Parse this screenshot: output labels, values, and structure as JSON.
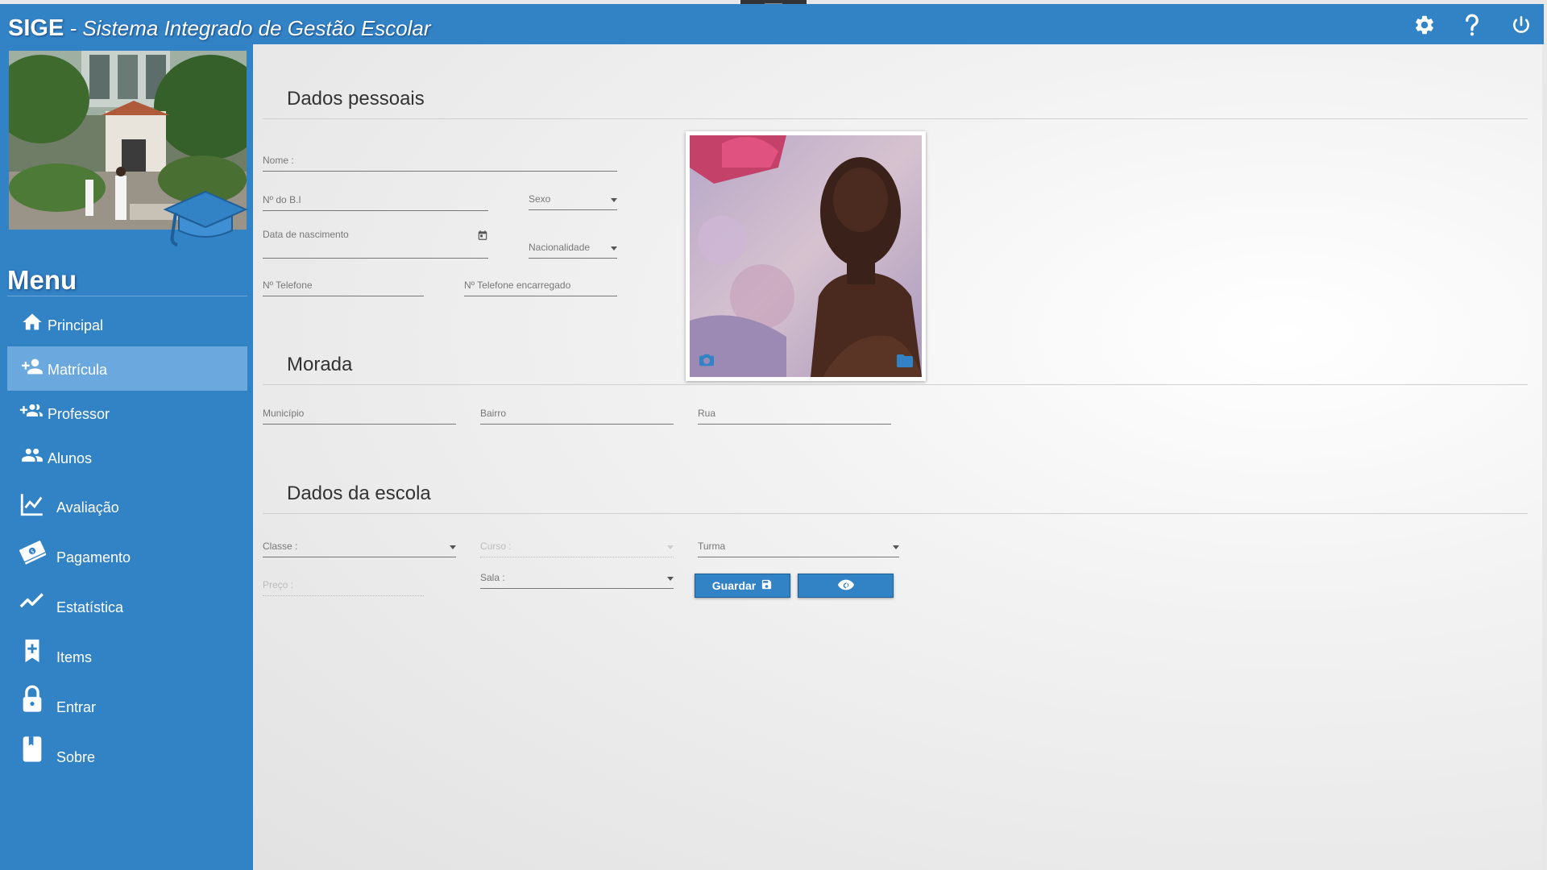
{
  "app": {
    "short_name": "SIGE",
    "separator": " - ",
    "long_name": "Sistema Integrado de Gestão Escolar",
    "accent_color": "#3282c6"
  },
  "header_icons": [
    "gear-icon",
    "help-icon",
    "power-icon"
  ],
  "sidebar": {
    "menu_title": "Menu",
    "items": [
      {
        "label": "Principal",
        "icon": "home-icon",
        "active": false
      },
      {
        "label": "Matrícula",
        "icon": "person-add-icon",
        "active": true
      },
      {
        "label": "Professor",
        "icon": "group-add-icon",
        "active": false
      },
      {
        "label": "Alunos",
        "icon": "people-icon",
        "active": false
      },
      {
        "label": "Avaliação",
        "icon": "chart-icon",
        "active": false
      },
      {
        "label": "Pagamento",
        "icon": "money-icon",
        "active": false
      },
      {
        "label": "Estatística",
        "icon": "trending-up-icon",
        "active": false
      },
      {
        "label": "Items",
        "icon": "bookmark-add-icon",
        "active": false
      },
      {
        "label": "Entrar",
        "icon": "lock-icon",
        "active": false
      },
      {
        "label": "Sobre",
        "icon": "book-icon",
        "active": false
      }
    ]
  },
  "personal": {
    "title": "Dados pessoais",
    "nome": "Nome :",
    "bi": "Nº do B.I",
    "sexo": "Sexo",
    "nascimento": "Data de nascimento",
    "nacionalidade": "Nacionalidade",
    "telefone": "Nº Telefone",
    "telefone_encarregado": "Nº Telefone encarregado"
  },
  "photo": {
    "camera_icon": "camera-icon",
    "folder_icon": "folder-icon"
  },
  "address": {
    "title": "Morada",
    "municipio": "Município",
    "bairro": "Bairro",
    "rua": "Rua"
  },
  "school": {
    "title": "Dados da escola",
    "classe": "Classe :",
    "curso": "Curso :",
    "turma": "Turma",
    "preco": "Preço :",
    "sala": "Sala :",
    "save_label": "Guardar"
  }
}
